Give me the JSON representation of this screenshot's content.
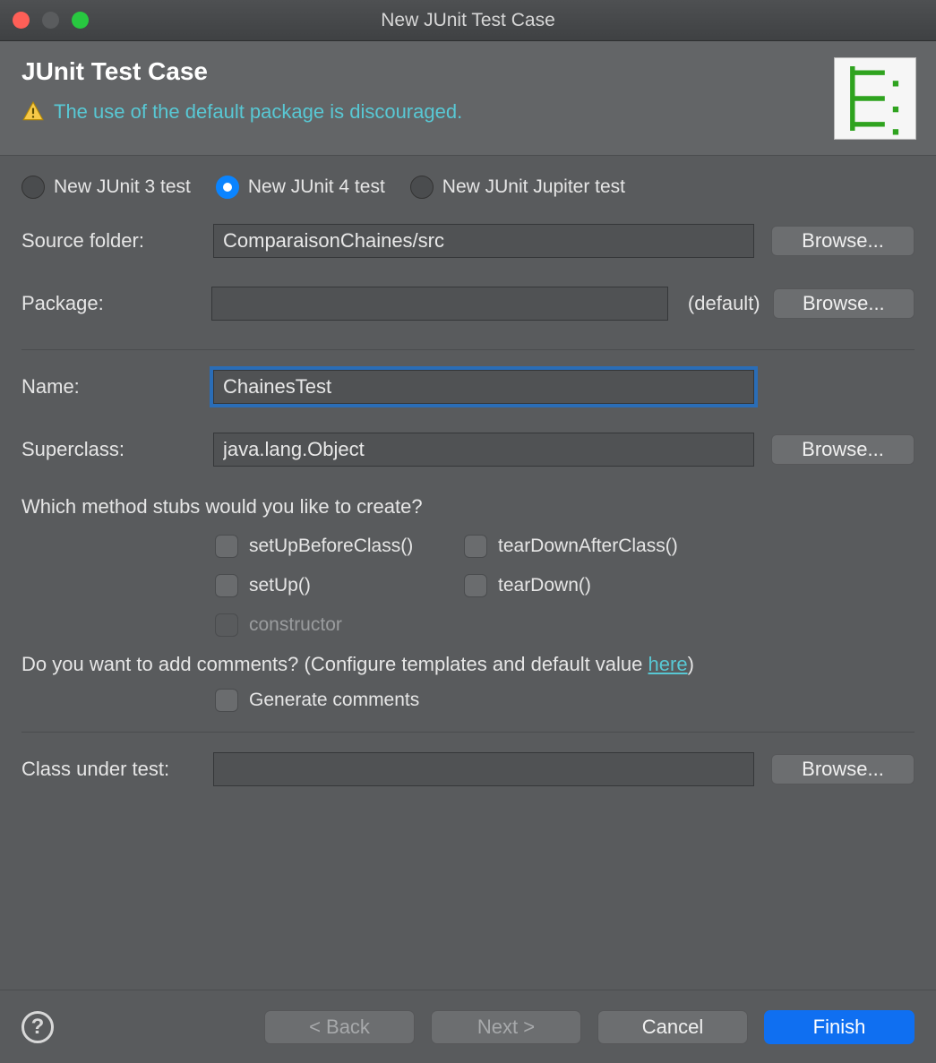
{
  "window": {
    "title": "New JUnit Test Case"
  },
  "header": {
    "heading": "JUnit Test Case",
    "warning": "The use of the default package is discouraged."
  },
  "radios": {
    "junit3": "New JUnit 3 test",
    "junit4": "New JUnit 4 test",
    "jupiter": "New JUnit Jupiter test",
    "selected": "junit4"
  },
  "labels": {
    "sourceFolder": "Source folder:",
    "package": "Package:",
    "packageDefault": "(default)",
    "name": "Name:",
    "superclass": "Superclass:",
    "classUnderTest": "Class under test:",
    "browse": "Browse..."
  },
  "values": {
    "sourceFolder": "ComparaisonChaines/src",
    "package": "",
    "name": "ChainesTest",
    "superclass": "java.lang.Object",
    "classUnderTest": ""
  },
  "stubs": {
    "question": "Which method stubs would you like to create?",
    "setUpBeforeClass": "setUpBeforeClass()",
    "tearDownAfterClass": "tearDownAfterClass()",
    "setUp": "setUp()",
    "tearDown": "tearDown()",
    "constructor": "constructor"
  },
  "comments": {
    "question_prefix": "Do you want to add comments? (Configure templates and default value ",
    "link": "here",
    "question_suffix": ")",
    "generate": "Generate comments"
  },
  "footer": {
    "back": "< Back",
    "next": "Next >",
    "cancel": "Cancel",
    "finish": "Finish"
  }
}
